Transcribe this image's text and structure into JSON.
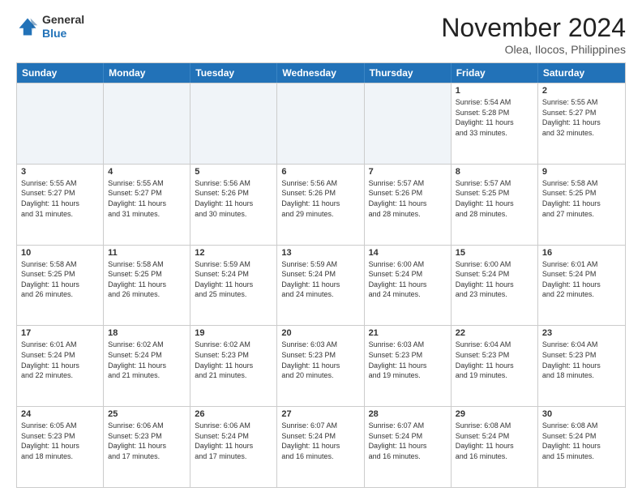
{
  "header": {
    "logo_line1": "General",
    "logo_line2": "Blue",
    "month": "November 2024",
    "location": "Olea, Ilocos, Philippines"
  },
  "weekdays": [
    "Sunday",
    "Monday",
    "Tuesday",
    "Wednesday",
    "Thursday",
    "Friday",
    "Saturday"
  ],
  "rows": [
    [
      {
        "day": "",
        "info": ""
      },
      {
        "day": "",
        "info": ""
      },
      {
        "day": "",
        "info": ""
      },
      {
        "day": "",
        "info": ""
      },
      {
        "day": "",
        "info": ""
      },
      {
        "day": "1",
        "info": "Sunrise: 5:54 AM\nSunset: 5:28 PM\nDaylight: 11 hours\nand 33 minutes."
      },
      {
        "day": "2",
        "info": "Sunrise: 5:55 AM\nSunset: 5:27 PM\nDaylight: 11 hours\nand 32 minutes."
      }
    ],
    [
      {
        "day": "3",
        "info": "Sunrise: 5:55 AM\nSunset: 5:27 PM\nDaylight: 11 hours\nand 31 minutes."
      },
      {
        "day": "4",
        "info": "Sunrise: 5:55 AM\nSunset: 5:27 PM\nDaylight: 11 hours\nand 31 minutes."
      },
      {
        "day": "5",
        "info": "Sunrise: 5:56 AM\nSunset: 5:26 PM\nDaylight: 11 hours\nand 30 minutes."
      },
      {
        "day": "6",
        "info": "Sunrise: 5:56 AM\nSunset: 5:26 PM\nDaylight: 11 hours\nand 29 minutes."
      },
      {
        "day": "7",
        "info": "Sunrise: 5:57 AM\nSunset: 5:26 PM\nDaylight: 11 hours\nand 28 minutes."
      },
      {
        "day": "8",
        "info": "Sunrise: 5:57 AM\nSunset: 5:25 PM\nDaylight: 11 hours\nand 28 minutes."
      },
      {
        "day": "9",
        "info": "Sunrise: 5:58 AM\nSunset: 5:25 PM\nDaylight: 11 hours\nand 27 minutes."
      }
    ],
    [
      {
        "day": "10",
        "info": "Sunrise: 5:58 AM\nSunset: 5:25 PM\nDaylight: 11 hours\nand 26 minutes."
      },
      {
        "day": "11",
        "info": "Sunrise: 5:58 AM\nSunset: 5:25 PM\nDaylight: 11 hours\nand 26 minutes."
      },
      {
        "day": "12",
        "info": "Sunrise: 5:59 AM\nSunset: 5:24 PM\nDaylight: 11 hours\nand 25 minutes."
      },
      {
        "day": "13",
        "info": "Sunrise: 5:59 AM\nSunset: 5:24 PM\nDaylight: 11 hours\nand 24 minutes."
      },
      {
        "day": "14",
        "info": "Sunrise: 6:00 AM\nSunset: 5:24 PM\nDaylight: 11 hours\nand 24 minutes."
      },
      {
        "day": "15",
        "info": "Sunrise: 6:00 AM\nSunset: 5:24 PM\nDaylight: 11 hours\nand 23 minutes."
      },
      {
        "day": "16",
        "info": "Sunrise: 6:01 AM\nSunset: 5:24 PM\nDaylight: 11 hours\nand 22 minutes."
      }
    ],
    [
      {
        "day": "17",
        "info": "Sunrise: 6:01 AM\nSunset: 5:24 PM\nDaylight: 11 hours\nand 22 minutes."
      },
      {
        "day": "18",
        "info": "Sunrise: 6:02 AM\nSunset: 5:24 PM\nDaylight: 11 hours\nand 21 minutes."
      },
      {
        "day": "19",
        "info": "Sunrise: 6:02 AM\nSunset: 5:23 PM\nDaylight: 11 hours\nand 21 minutes."
      },
      {
        "day": "20",
        "info": "Sunrise: 6:03 AM\nSunset: 5:23 PM\nDaylight: 11 hours\nand 20 minutes."
      },
      {
        "day": "21",
        "info": "Sunrise: 6:03 AM\nSunset: 5:23 PM\nDaylight: 11 hours\nand 19 minutes."
      },
      {
        "day": "22",
        "info": "Sunrise: 6:04 AM\nSunset: 5:23 PM\nDaylight: 11 hours\nand 19 minutes."
      },
      {
        "day": "23",
        "info": "Sunrise: 6:04 AM\nSunset: 5:23 PM\nDaylight: 11 hours\nand 18 minutes."
      }
    ],
    [
      {
        "day": "24",
        "info": "Sunrise: 6:05 AM\nSunset: 5:23 PM\nDaylight: 11 hours\nand 18 minutes."
      },
      {
        "day": "25",
        "info": "Sunrise: 6:06 AM\nSunset: 5:23 PM\nDaylight: 11 hours\nand 17 minutes."
      },
      {
        "day": "26",
        "info": "Sunrise: 6:06 AM\nSunset: 5:24 PM\nDaylight: 11 hours\nand 17 minutes."
      },
      {
        "day": "27",
        "info": "Sunrise: 6:07 AM\nSunset: 5:24 PM\nDaylight: 11 hours\nand 16 minutes."
      },
      {
        "day": "28",
        "info": "Sunrise: 6:07 AM\nSunset: 5:24 PM\nDaylight: 11 hours\nand 16 minutes."
      },
      {
        "day": "29",
        "info": "Sunrise: 6:08 AM\nSunset: 5:24 PM\nDaylight: 11 hours\nand 16 minutes."
      },
      {
        "day": "30",
        "info": "Sunrise: 6:08 AM\nSunset: 5:24 PM\nDaylight: 11 hours\nand 15 minutes."
      }
    ]
  ]
}
